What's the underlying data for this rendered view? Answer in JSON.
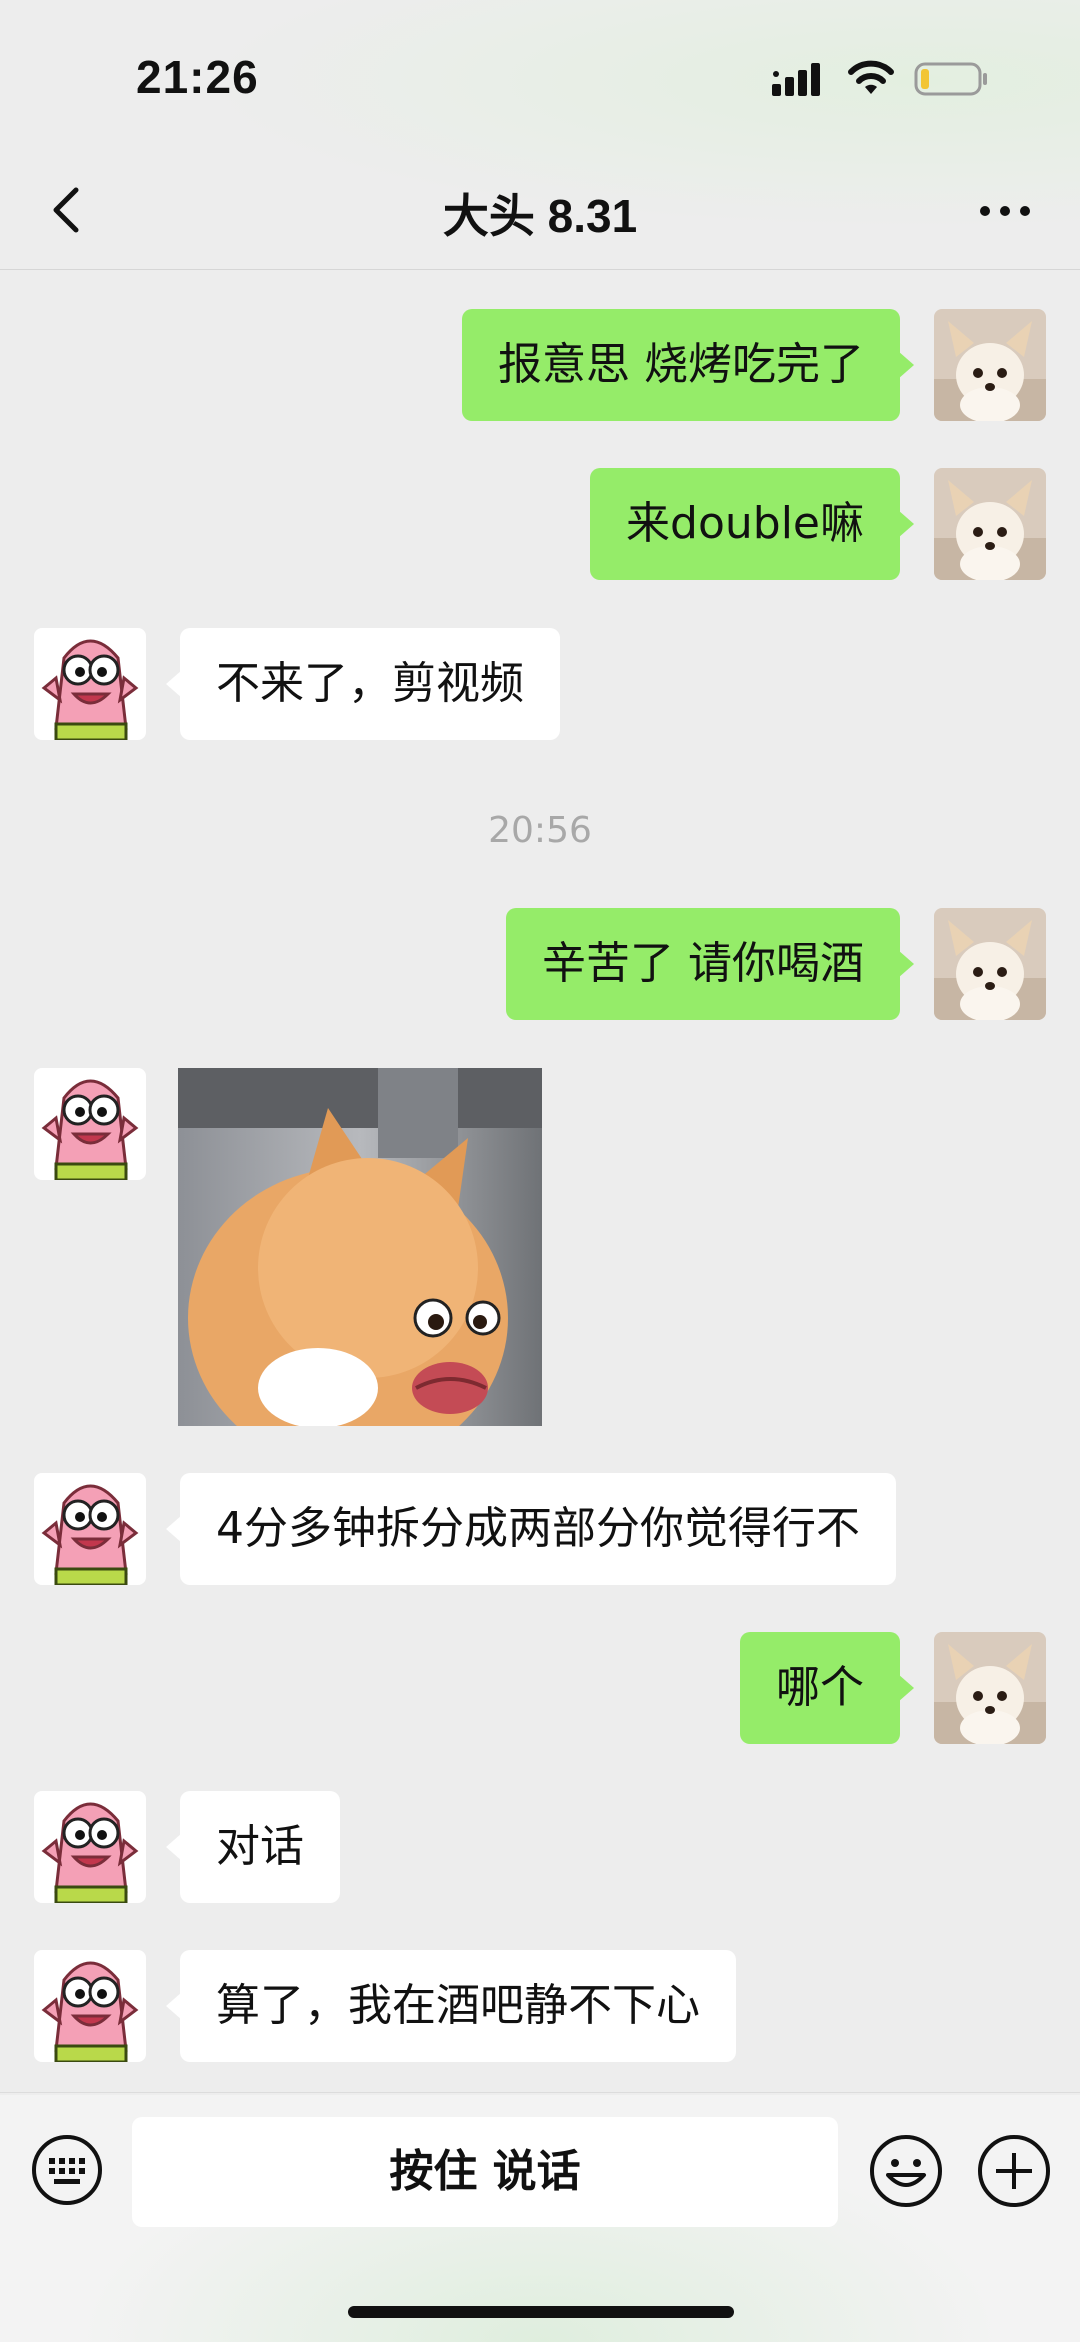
{
  "status_bar": {
    "time": "21:26"
  },
  "nav": {
    "title": "大头 8.31"
  },
  "messages": [
    {
      "side": "right",
      "text": "报意思 烧烤吃完了"
    },
    {
      "side": "right",
      "text": "来double嘛"
    },
    {
      "side": "left",
      "text": "不来了，剪视频"
    },
    {
      "timestamp": "20:56"
    },
    {
      "side": "right",
      "text": "辛苦了 请你喝酒"
    },
    {
      "side": "left",
      "sticker": "orange-cat-funny-face-sticker"
    },
    {
      "side": "left",
      "text": "4分多钟拆分成两部分你觉得行不"
    },
    {
      "side": "right",
      "text": "哪个"
    },
    {
      "side": "left",
      "text": "对话"
    },
    {
      "side": "left",
      "text": "算了，我在酒吧静不下心"
    }
  ],
  "input_bar": {
    "voice_label": "按住 说话"
  },
  "colors": {
    "sent_bubble": "#95ec69",
    "received_bubble": "#ffffff",
    "background": "#ededed"
  },
  "icons": [
    "back-icon",
    "more-icon",
    "keyboard-icon",
    "emoji-icon",
    "plus-icon",
    "signal-icon",
    "wifi-icon",
    "battery-icon"
  ]
}
